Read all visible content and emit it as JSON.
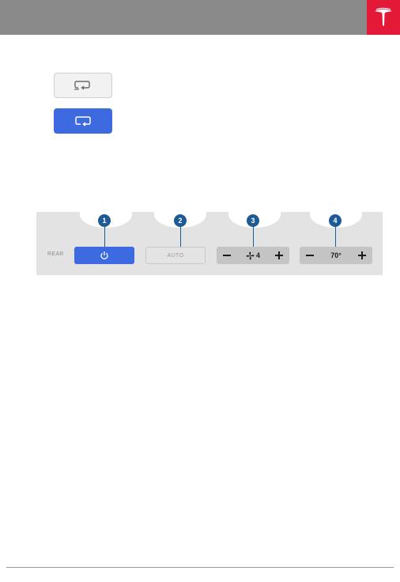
{
  "header": {
    "logo_icon": "tesla-logo-icon",
    "bar_color": "#8a8a8a",
    "logo_bg_color": "#e31937"
  },
  "recirculation": {
    "outside_air_icon": "outside-air-recirculation-icon",
    "inside_air_icon": "inside-air-recirculation-icon",
    "active_color": "#3e6ae1"
  },
  "rear_controls": {
    "rear_label": "REAR",
    "power_icon": "power-icon",
    "auto_label": "AUTO",
    "fan": {
      "icon": "fan-icon",
      "speed": "4",
      "minus_icon": "minus-icon",
      "plus_icon": "plus-icon"
    },
    "temperature": {
      "value": "70°",
      "minus_icon": "minus-icon",
      "plus_icon": "plus-icon"
    }
  },
  "callouts": [
    "1",
    "2",
    "3",
    "4"
  ]
}
